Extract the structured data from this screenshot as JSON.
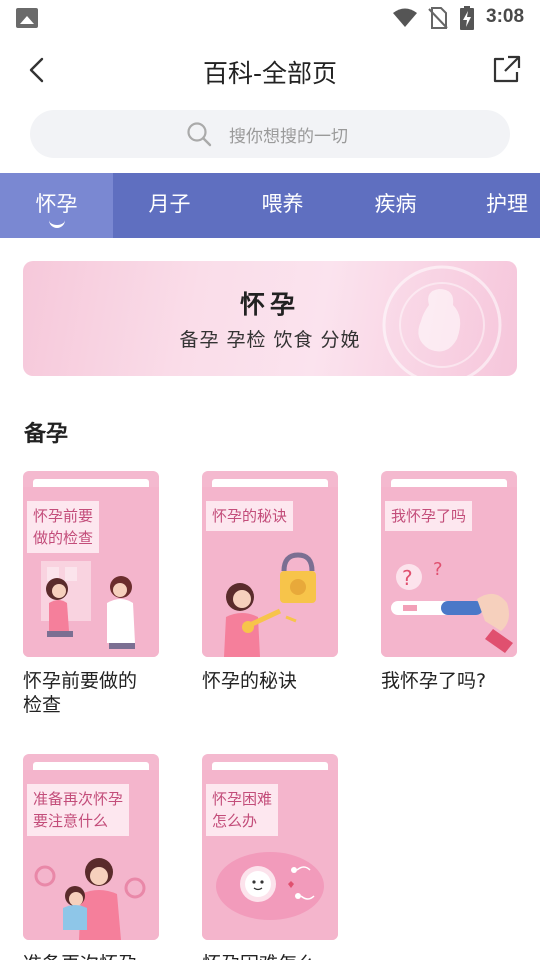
{
  "status_bar": {
    "time": "3:08",
    "icons": [
      "image-icon",
      "wifi-icon",
      "no-sim-icon",
      "battery-charging-icon"
    ]
  },
  "header": {
    "title": "百科-全部页",
    "back_icon": "chevron-left-icon",
    "share_icon": "share-external-icon"
  },
  "search": {
    "placeholder": "搜你想搜的一切"
  },
  "tabs": [
    {
      "label": "怀孕",
      "active": true
    },
    {
      "label": "月子",
      "active": false
    },
    {
      "label": "喂养",
      "active": false
    },
    {
      "label": "疾病",
      "active": false
    },
    {
      "label": "护理",
      "active": false
    }
  ],
  "banner": {
    "title": "怀孕",
    "subtitle": "备孕 孕检 饮食 分娩"
  },
  "section": {
    "title": "备孕"
  },
  "cards": [
    {
      "label": "怀孕前要\n做的检查",
      "title": "怀孕前要做的\n检查",
      "art": "doctor-consultation-illustration"
    },
    {
      "label": "怀孕的秘诀",
      "title": "怀孕的秘诀",
      "art": "key-lock-illustration"
    },
    {
      "label": "我怀孕了吗",
      "title": "我怀孕了吗?",
      "art": "pregnancy-test-illustration"
    },
    {
      "label": "准备再次怀孕\n要注意什么",
      "title": "准备再次怀孕",
      "art": "mother-baby-illustration"
    },
    {
      "label": "怀孕困难\n怎么办",
      "title": "怀孕困难怎么",
      "art": "egg-sperm-illustration"
    }
  ],
  "colors": {
    "tab_bar": "#5f6fc0",
    "tab_active": "#7a88d2",
    "folder_pink": "#f4b5cc",
    "label_text": "#c34d7a"
  }
}
